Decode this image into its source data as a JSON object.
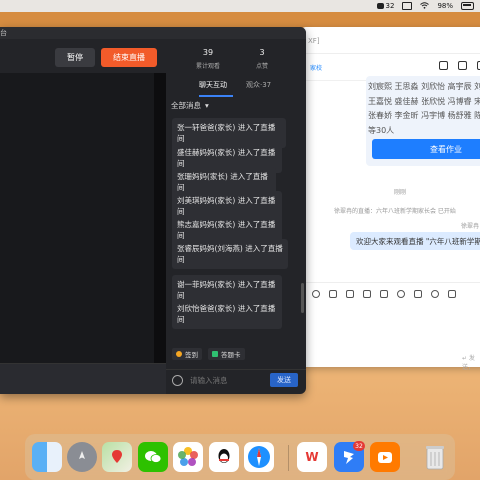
{
  "menubar": {
    "chat_count": "32",
    "battery": "98%"
  },
  "live": {
    "window_title": "台",
    "pause_label": "暂停",
    "end_label": "结束直播",
    "views_value": "39",
    "views_label": "累计观看",
    "likes_value": "3",
    "likes_label": "点赞",
    "tab_chat": "聊天互动",
    "tab_viewers": "观众·37",
    "filter_label": "全部消息",
    "messages": [
      "张一轩爸爸(家长) 进入了直播间",
      "盛佳赫妈妈(家长) 进入了直播间",
      "张珊妈妈(家长) 进入了直播间",
      "刘美琪妈妈(家长) 进入了直播间",
      "熊志嘉妈妈(家长) 进入了直播间",
      "张睿辰妈妈(刘海燕) 进入了直播间",
      "谢一菲妈妈(家长) 进入了直播间",
      "刘欣怡爸爸(家长) 进入了直播间"
    ],
    "signin_label": "签到",
    "quiz_label": "答题卡",
    "input_placeholder": "请输入消息",
    "send_label": "发送"
  },
  "chat": {
    "title_fragment": "XF]",
    "tag": "家校",
    "names_lines": [
      "刘宸熙 王思淼 刘欣怡 高宇辰 刘",
      "王嘉悦 盛佳赫 张欣悦 冯博睿 宋",
      "张春娇 李金昕 冯宇博 杨舒雅 陈",
      "等30人"
    ],
    "homework_button": "查看作业",
    "system_just_now": "刚刚",
    "system_started": "徐翠冉的直播：六年八班新学期家长会 已开始",
    "sender_name": "徐翠冉",
    "bubble_text": "欢迎大家来观看直播 \"六年八班新学期",
    "send_hint": "↵ 发送，",
    "accent": "#1e7eff"
  },
  "dock": {
    "apps": [
      "finder-icon",
      "launchpad-icon",
      "maps-icon",
      "wechat-icon",
      "photos-icon",
      "qq-icon",
      "safari-icon",
      "wps-icon",
      "dingtalk-icon",
      "taobao-icon",
      "trash-icon"
    ],
    "dingtalk_badge": "32"
  }
}
